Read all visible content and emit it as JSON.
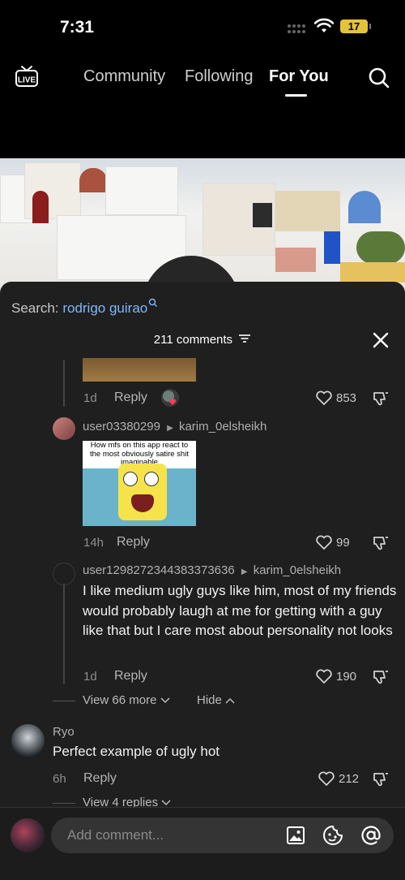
{
  "status": {
    "time": "7:31",
    "battery": "17"
  },
  "nav": {
    "tabs": [
      "Community",
      "Following",
      "For You"
    ]
  },
  "search": {
    "prefix": "Search:",
    "query": "rodrigo guirao"
  },
  "comments_header": "211 comments",
  "comments": {
    "c0": {
      "time": "1d",
      "reply": "Reply",
      "likes": "853"
    },
    "c1": {
      "user": "user03380299",
      "reply_to": "karim_0elsheikh",
      "meme_caption": "How mfs on this app react to the most obviously satire shit imaginable",
      "time": "14h",
      "reply": "Reply",
      "likes": "99"
    },
    "c2": {
      "user": "user1298272344383373636",
      "reply_to": "karim_0elsheikh",
      "text": "I like medium ugly guys like him, most of my friends would probably laugh at me for getting with a guy like that but I care most about personality not looks",
      "time": "1d",
      "reply": "Reply",
      "likes": "190"
    },
    "thread_controls": {
      "view_more": "View 66 more",
      "hide": "Hide"
    },
    "c3": {
      "user": "Ryo",
      "text": "Perfect example of ugly hot",
      "time": "6h",
      "reply": "Reply",
      "likes": "212",
      "view_replies": "View 4 replies"
    }
  },
  "composer": {
    "placeholder": "Add comment..."
  }
}
